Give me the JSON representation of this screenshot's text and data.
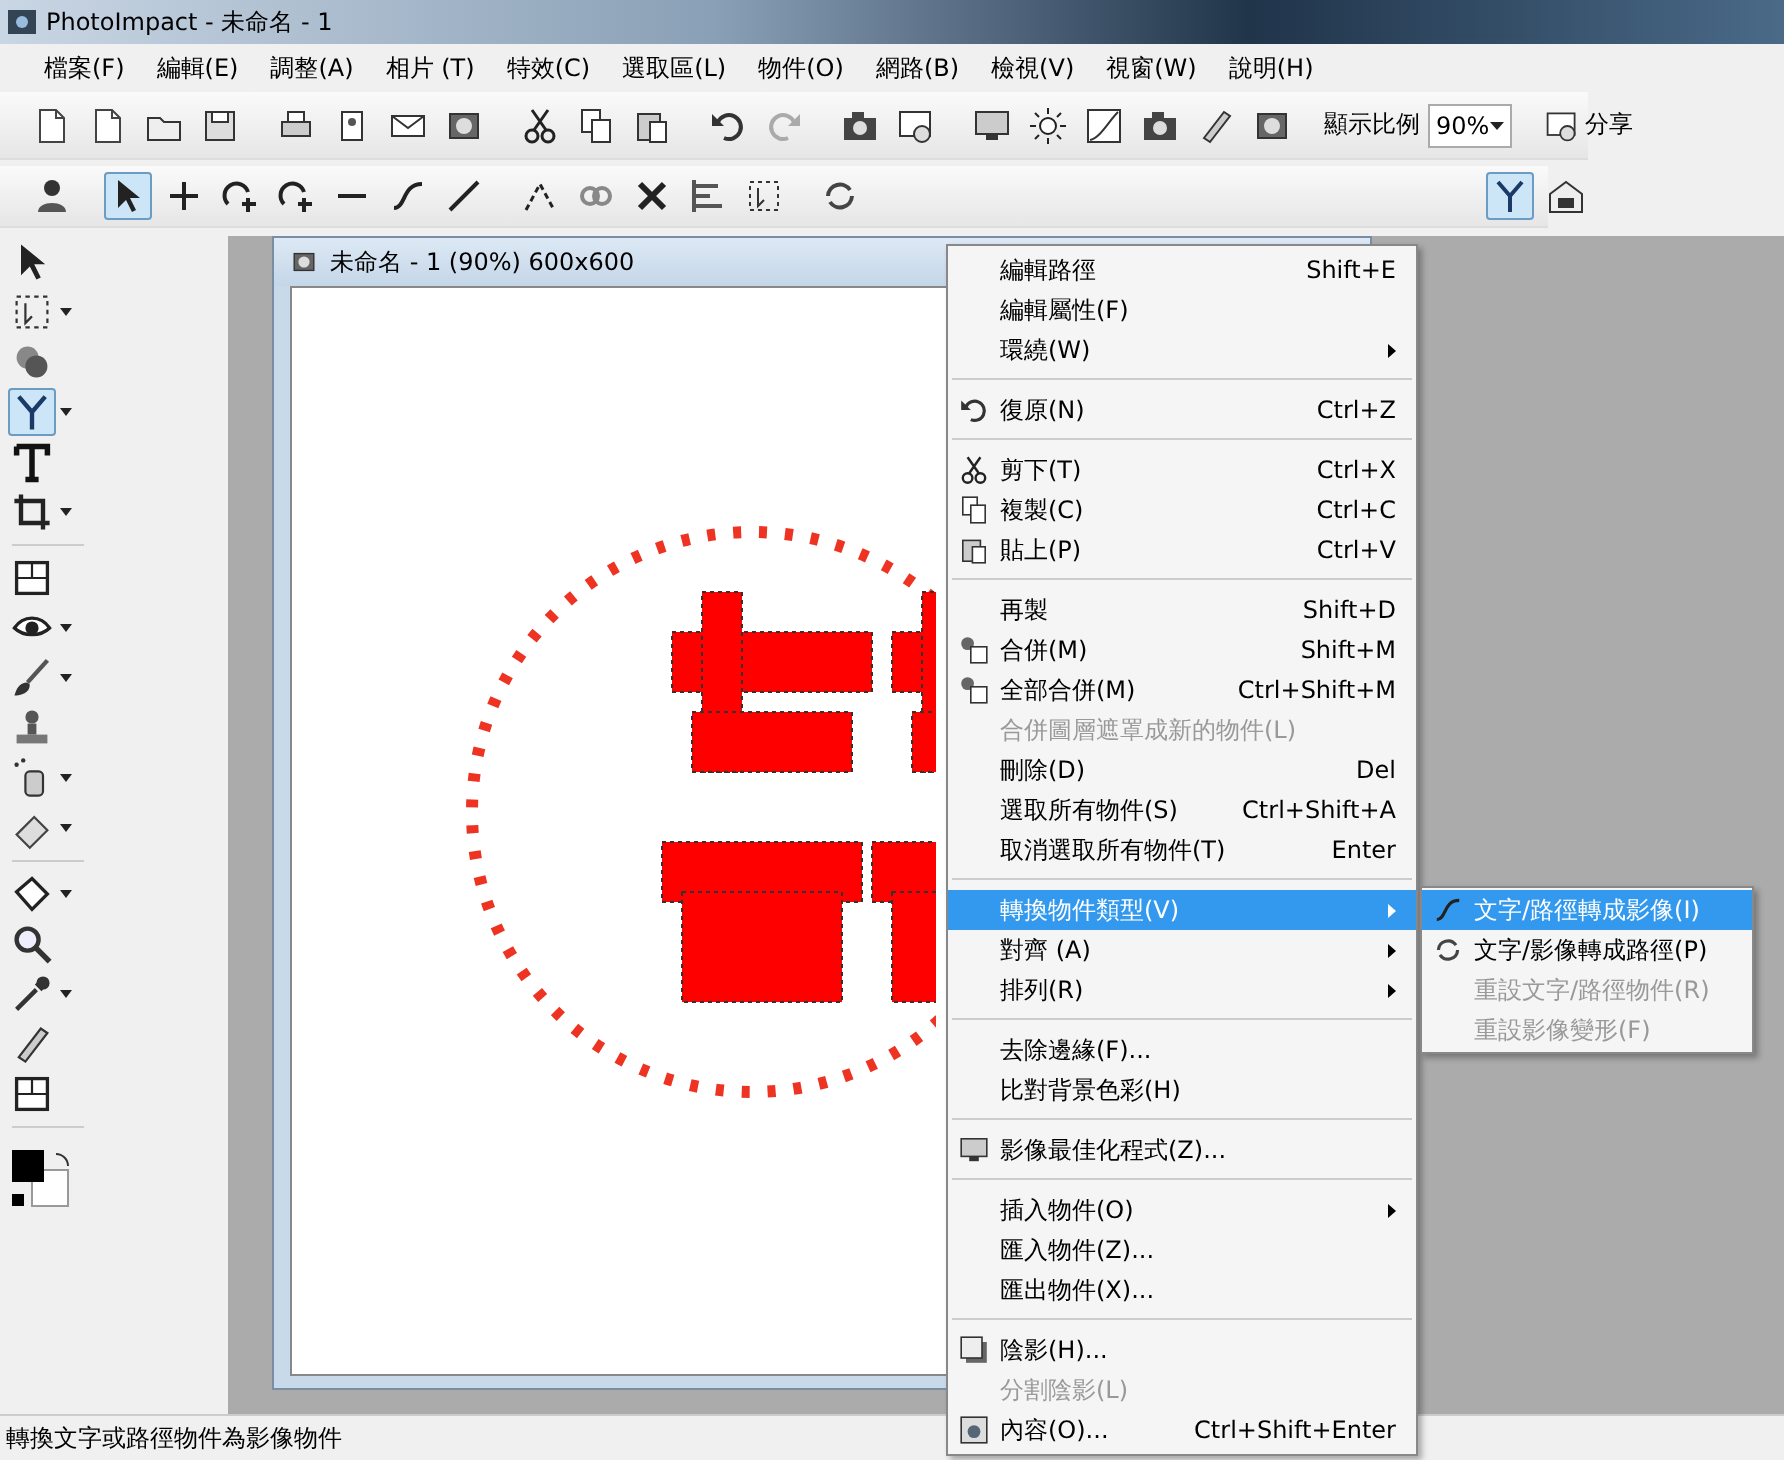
{
  "window": {
    "title": "PhotoImpact - 未命名 - 1"
  },
  "menu_bar": [
    "檔案(F)",
    "編輯(E)",
    "調整(A)",
    "相片 (T)",
    "特效(C)",
    "選取區(L)",
    "物件(O)",
    "網路(B)",
    "檢視(V)",
    "視窗(W)",
    "說明(H)"
  ],
  "standard_toolbar": {
    "zoom_label": "顯示比例",
    "zoom_value": "90%",
    "share_label": "分享"
  },
  "path_toolbar": {
    "tools": [
      {
        "selected": false
      },
      {
        "selected": true
      },
      {
        "selected": false
      },
      {
        "selected": false
      },
      {
        "selected": false
      },
      {
        "selected": false
      },
      {
        "selected": false
      },
      {
        "selected": false
      },
      {
        "selected": false
      },
      {
        "selected": false
      },
      {
        "selected": false
      },
      {
        "selected": false
      },
      {
        "selected": false
      },
      {
        "selected": false
      },
      {
        "selected": true
      },
      {
        "selected": false
      }
    ]
  },
  "toolbox": {
    "tools": [
      {
        "selected": false,
        "has_dropdown": false
      },
      {
        "selected": false,
        "has_dropdown": true
      },
      {
        "selected": false,
        "has_dropdown": false
      },
      {
        "selected": true,
        "has_dropdown": true
      },
      {
        "selected": false,
        "has_dropdown": false
      },
      {
        "selected": false,
        "has_dropdown": true
      },
      {
        "selected": false,
        "has_dropdown": false
      },
      {
        "selected": false,
        "has_dropdown": true
      },
      {
        "selected": false,
        "has_dropdown": true
      },
      {
        "selected": false,
        "has_dropdown": false
      },
      {
        "selected": false,
        "has_dropdown": true
      },
      {
        "selected": false,
        "has_dropdown": true
      },
      {
        "selected": false,
        "has_dropdown": true
      },
      {
        "selected": false,
        "has_dropdown": false
      },
      {
        "selected": false,
        "has_dropdown": true
      },
      {
        "selected": false,
        "has_dropdown": false
      },
      {
        "selected": false,
        "has_dropdown": false
      }
    ]
  },
  "document": {
    "title": "未命名 - 1 (90%) 600x600"
  },
  "context_menu": {
    "items": [
      {
        "kind": "item",
        "label": "編輯路徑",
        "shortcut": "Shift+E",
        "disabled": false,
        "selected": false,
        "submenu": false
      },
      {
        "kind": "item",
        "label": "編輯屬性(F)",
        "disabled": false,
        "selected": false,
        "submenu": false
      },
      {
        "kind": "item",
        "label": "環繞(W)",
        "disabled": false,
        "selected": false,
        "submenu": true
      },
      {
        "kind": "separator"
      },
      {
        "kind": "item",
        "label": "復原(N)",
        "shortcut": "Ctrl+Z",
        "disabled": false,
        "selected": false,
        "submenu": false
      },
      {
        "kind": "separator"
      },
      {
        "kind": "item",
        "label": "剪下(T)",
        "shortcut": "Ctrl+X",
        "disabled": false,
        "selected": false,
        "submenu": false
      },
      {
        "kind": "item",
        "label": "複製(C)",
        "shortcut": "Ctrl+C",
        "disabled": false,
        "selected": false,
        "submenu": false
      },
      {
        "kind": "item",
        "label": "貼上(P)",
        "shortcut": "Ctrl+V",
        "disabled": false,
        "selected": false,
        "submenu": false
      },
      {
        "kind": "separator"
      },
      {
        "kind": "item",
        "label": "再製",
        "shortcut": "Shift+D",
        "disabled": false,
        "selected": false,
        "submenu": false
      },
      {
        "kind": "item",
        "label": "合併(M)",
        "shortcut": "Shift+M",
        "disabled": false,
        "selected": false,
        "submenu": false
      },
      {
        "kind": "item",
        "label": "全部合併(M)",
        "shortcut": "Ctrl+Shift+M",
        "disabled": false,
        "selected": false,
        "submenu": false
      },
      {
        "kind": "item",
        "label": "合併圖層遮罩成新的物件(L)",
        "disabled": true,
        "selected": false,
        "submenu": false
      },
      {
        "kind": "item",
        "label": "刪除(D)",
        "shortcut": "Del",
        "disabled": false,
        "selected": false,
        "submenu": false
      },
      {
        "kind": "item",
        "label": "選取所有物件(S)",
        "shortcut": "Ctrl+Shift+A",
        "disabled": false,
        "selected": false,
        "submenu": false
      },
      {
        "kind": "item",
        "label": "取消選取所有物件(T)",
        "shortcut": "Enter",
        "disabled": false,
        "selected": false,
        "submenu": false
      },
      {
        "kind": "separator"
      },
      {
        "kind": "item",
        "label": "轉換物件類型(V)",
        "disabled": false,
        "selected": true,
        "submenu": true
      },
      {
        "kind": "item",
        "label": "對齊 (A)",
        "disabled": false,
        "selected": false,
        "submenu": true
      },
      {
        "kind": "item",
        "label": "排列(R)",
        "disabled": false,
        "selected": false,
        "submenu": true
      },
      {
        "kind": "separator"
      },
      {
        "kind": "item",
        "label": "去除邊緣(F)...",
        "disabled": false,
        "selected": false,
        "submenu": false
      },
      {
        "kind": "item",
        "label": "比對背景色彩(H)",
        "disabled": false,
        "selected": false,
        "submenu": false
      },
      {
        "kind": "separator"
      },
      {
        "kind": "item",
        "label": "影像最佳化程式(Z)...",
        "disabled": false,
        "selected": false,
        "submenu": false
      },
      {
        "kind": "separator"
      },
      {
        "kind": "item",
        "label": "插入物件(O)",
        "disabled": false,
        "selected": false,
        "submenu": true
      },
      {
        "kind": "item",
        "label": "匯入物件(Z)...",
        "disabled": false,
        "selected": false,
        "submenu": false
      },
      {
        "kind": "item",
        "label": "匯出物件(X)...",
        "disabled": false,
        "selected": false,
        "submenu": false
      },
      {
        "kind": "separator"
      },
      {
        "kind": "item",
        "label": "陰影(H)...",
        "disabled": false,
        "selected": false,
        "submenu": false
      },
      {
        "kind": "item",
        "label": "分割陰影(L)",
        "disabled": true,
        "selected": false,
        "submenu": false
      },
      {
        "kind": "item",
        "label": "內容(O)...",
        "shortcut": "Ctrl+Shift+Enter",
        "disabled": false,
        "selected": false,
        "submenu": false
      }
    ]
  },
  "submenu": {
    "items": [
      {
        "label": "文字/路徑轉成影像(I)",
        "disabled": false,
        "selected": true
      },
      {
        "label": "文字/影像轉成路徑(P)",
        "disabled": false,
        "selected": false
      },
      {
        "label": "重設文字/路徑物件(R)",
        "disabled": true,
        "selected": false
      },
      {
        "label": "重設影像變形(F)",
        "disabled": true,
        "selected": false
      }
    ]
  },
  "status_bar": {
    "text": "轉換文字或路徑物件為影像物件"
  }
}
